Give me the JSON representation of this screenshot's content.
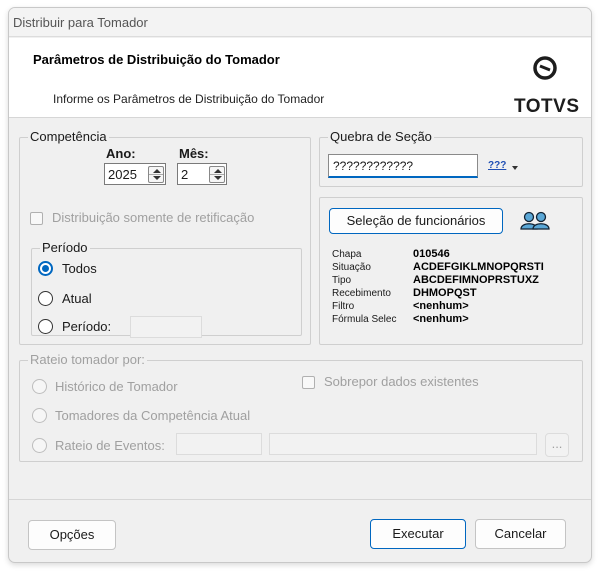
{
  "window": {
    "title": "Distribuir para Tomador"
  },
  "header": {
    "title": "Parâmetros de Distribuição do Tomador",
    "subtitle": "Informe os Parâmetros de Distribuição do Tomador",
    "logo_text": "TOTVS"
  },
  "competencia": {
    "title": "Competência",
    "ano_label": "Ano:",
    "ano_value": "2025",
    "mes_label": "Mês:",
    "mes_value": "2",
    "retificacao_label": "Distribuição somente de retificação"
  },
  "periodo": {
    "title": "Período",
    "options": [
      "Todos",
      "Atual",
      "Período:"
    ],
    "selected": "Todos"
  },
  "quebra": {
    "title": "Quebra de Seção",
    "value": "????????????",
    "menu_label": "???"
  },
  "selecao": {
    "button_label": "Seleção de funcionários",
    "rows": [
      {
        "label": "Chapa",
        "value": "010546"
      },
      {
        "label": "Situação",
        "value": "ACDEFGIKLMNOPQRSTI"
      },
      {
        "label": "Tipo",
        "value": "ABCDEFIMNOPRSTUXZ"
      },
      {
        "label": "Recebimento",
        "value": "DHMOPQST"
      },
      {
        "label": "Filtro",
        "value": "<nenhum>"
      },
      {
        "label": "Fórmula Selec",
        "value": "<nenhum>"
      }
    ]
  },
  "rateio": {
    "title": "Rateio tomador por:",
    "options": [
      "Histórico de Tomador",
      "Tomadores da Competência Atual",
      "Rateio de Eventos:"
    ],
    "sobrepor_label": "Sobrepor dados existentes",
    "browse_label": "..."
  },
  "footer": {
    "opcoes": "Opções",
    "executar": "Executar",
    "cancelar": "Cancelar"
  },
  "colors": {
    "accent": "#0067c0",
    "background": "#f0f0f0",
    "border": "#cfcfcf"
  }
}
